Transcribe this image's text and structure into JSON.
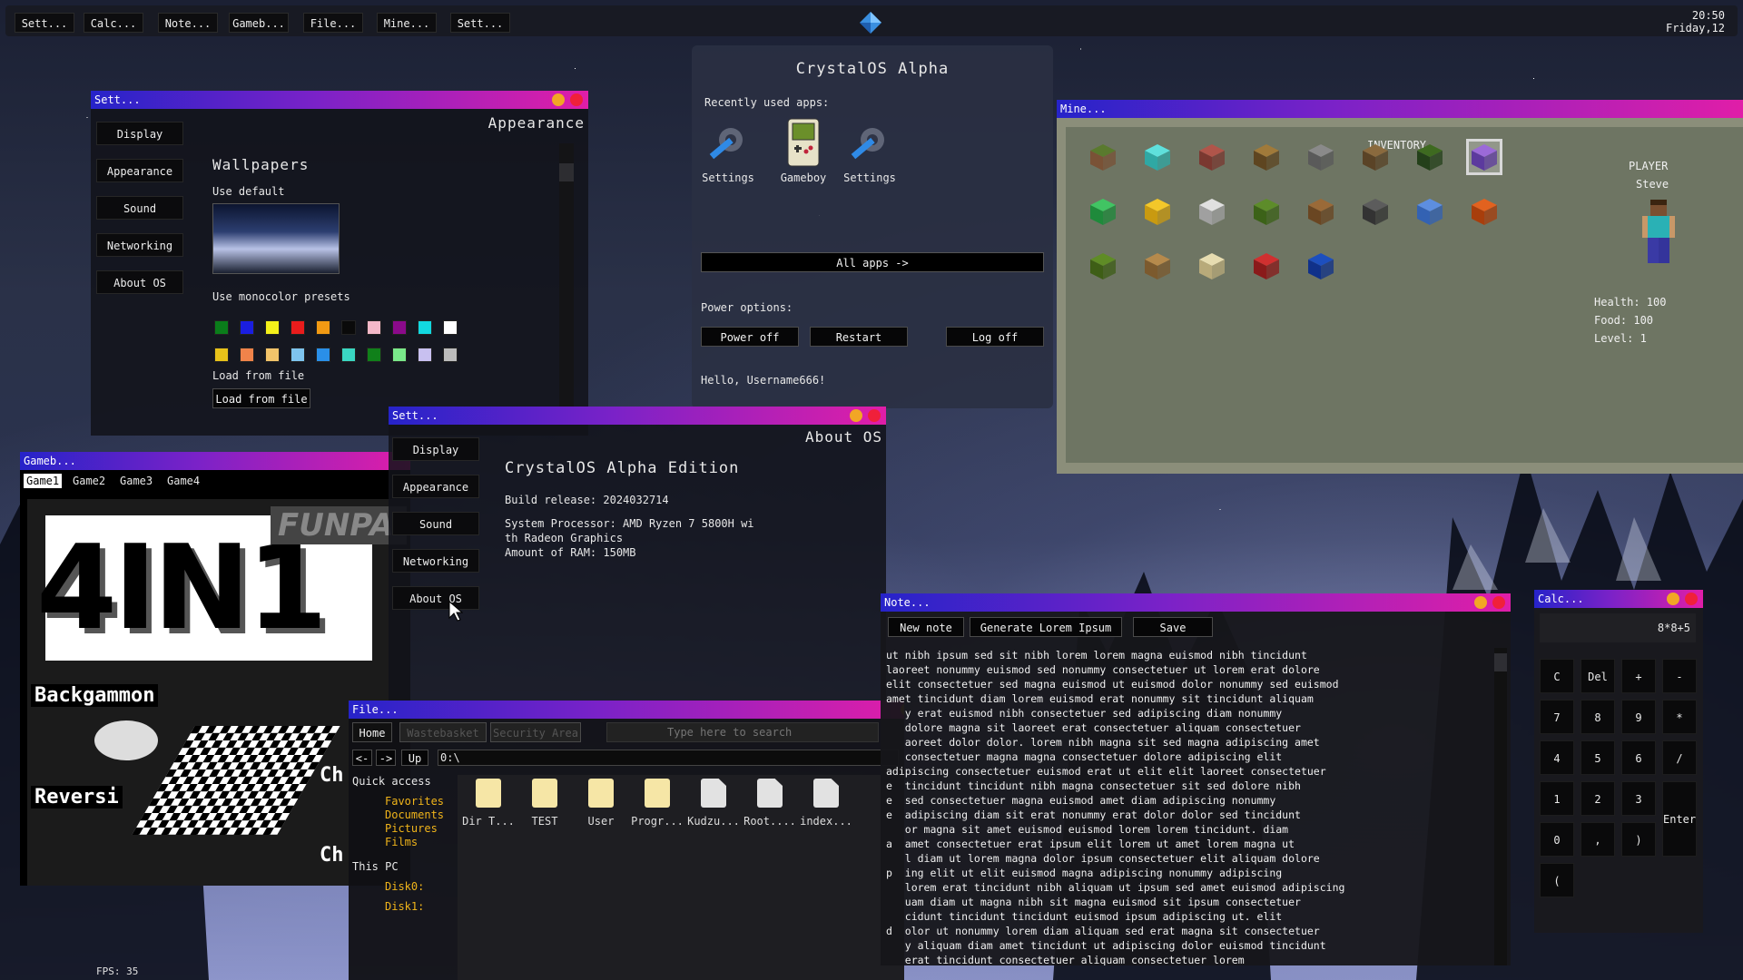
{
  "taskbar": {
    "apps": [
      "Sett...",
      "Calc...",
      "Note...",
      "Gameb...",
      "File...",
      "Mine...",
      "Sett..."
    ],
    "time": "20:50",
    "date": "Friday,12"
  },
  "start_menu": {
    "title": "CrystalOS Alpha",
    "recent_label": "Recently used apps:",
    "recent_apps": [
      "Settings",
      "Gameboy",
      "Settings"
    ],
    "all_apps_label": "All apps ->",
    "power_label": "Power options:",
    "power_off": "Power off",
    "restart": "Restart",
    "log_off": "Log off",
    "greeting": "Hello, Username666!"
  },
  "settings_1": {
    "title": "Sett...",
    "header": "Appearance",
    "nav": [
      "Display",
      "Appearance",
      "Sound",
      "Networking",
      "About OS"
    ],
    "wallpapers_heading": "Wallpapers",
    "use_default": "Use default",
    "monocolor_label": "Use monocolor presets",
    "load_label": "Load from file",
    "load_button": "Load from file",
    "swatches_row1": [
      "#0a7d1a",
      "#1a1ee0",
      "#f4f01a",
      "#e91c1c",
      "#f29a13",
      "#0a0a0a",
      "#f4b8c8",
      "#8b0a8b",
      "#12d8e0",
      "#ffffff"
    ],
    "swatches_row2": [
      "#e8c21a",
      "#f0834a",
      "#f2c46a",
      "#7ec4ee",
      "#2a8fe8",
      "#3ad6c2",
      "#10801a",
      "#7ae88a",
      "#c8c0f0",
      "#bcbcbc"
    ]
  },
  "settings_2": {
    "title": "Sett...",
    "header": "About OS",
    "nav": [
      "Display",
      "Appearance",
      "Sound",
      "Networking",
      "About OS"
    ],
    "edition": "CrystalOS Alpha Edition",
    "build": "Build release: 2024032714",
    "processor_1": "System Processor: AMD Ryzen 7 5800H wi",
    "processor_2": "th Radeon Graphics",
    "ram": "Amount of RAM: 150MB"
  },
  "minecraft": {
    "title": "Mine...",
    "inventory_label": "INVENTORY",
    "player_label": "PLAYER",
    "player_name": "Steve",
    "health": "Health: 100",
    "food": "Food: 100",
    "level": "Level: 1"
  },
  "gameboy": {
    "title": "Gameb...",
    "tabs": [
      "Game1",
      "Game2",
      "Game3",
      "Game4"
    ],
    "banner": "4IN1",
    "banner_sub": "FUNPA",
    "game_backgammon": "Backgammon",
    "game_reversi": "Reversi",
    "game_ch1": "Ch",
    "game_ch2": "Ch",
    "fps": "FPS: 35"
  },
  "file_manager": {
    "title": "File...",
    "tabs": [
      "Home",
      "Wastebasket",
      "Security Area"
    ],
    "search_placeholder": "Type here to search",
    "back": "<-",
    "forward": "->",
    "up": "Up",
    "path": "0:\\",
    "quick_access": "Quick access",
    "quick_items": [
      "Favorites",
      "Documents",
      "Pictures",
      "Films"
    ],
    "this_pc": "This PC",
    "disks": [
      "Disk0:",
      "Disk1:"
    ],
    "items": [
      "Dir T...",
      "TEST",
      "User",
      "Progr...",
      "Kudzu...",
      "Root....",
      "index..."
    ]
  },
  "notepad": {
    "title": "Note...",
    "new_note": "New note",
    "generate": "Generate Lorem Ipsum",
    "save": "Save",
    "lines": [
      "ut nibh ipsum sed sit nibh lorem lorem magna euismod nibh tincidunt",
      "laoreet nonummy euismod sed nonummy consectetuer ut lorem erat dolore",
      "elit consectetuer sed magna euismod ut euismod dolor nonummy sed euismod",
      "amet tincidunt diam lorem euismod erat nonummy sit tincidunt aliquam",
      "   y erat euismod nibh consectetuer sed adipiscing diam nonummy",
      "   dolore magna sit laoreet erat consectetuer aliquam consectetuer",
      "   aoreet dolor dolor. lorem nibh magna sit sed magna adipiscing amet",
      "   consectetuer magna magna consectetuer dolore adipiscing elit",
      "adipiscing consectetuer euismod erat ut elit elit laoreet consectetuer",
      "e  tincidunt tincidunt nibh magna consectetuer sit sed dolore nibh",
      "e  sed consectetuer magna euismod amet diam adipiscing nonummy",
      "e  adipiscing diam sit erat nonummy erat dolor dolor sed tincidunt",
      "   or magna sit amet euismod euismod lorem lorem tincidunt. diam",
      "a  amet consectetuer erat ipsum elit lorem ut amet lorem magna ut",
      "   l diam ut lorem magna dolor ipsum consectetuer elit aliquam dolore",
      "p  ing elit ut elit euismod magna adipiscing nonummy adipiscing",
      "   lorem erat tincidunt nibh aliquam ut ipsum sed amet euismod adipiscing",
      "   uam diam ut magna nibh sit magna euismod sit ipsum consectetuer",
      "   cidunt tincidunt tincidunt euismod ipsum adipiscing ut. elit",
      "d  olor ut nonummy lorem diam aliquam sed erat magna sit consectetuer",
      "   y aliquam diam amet tincidunt ut adipiscing dolor euismod tincidunt",
      "   erat tincidunt consectetuer aliquam consectetuer lorem"
    ]
  },
  "calculator": {
    "title": "Calc...",
    "display": "8*8+5",
    "keys": [
      "C",
      "Del",
      "+",
      "-",
      "7",
      "8",
      "9",
      "*",
      "4",
      "5",
      "6",
      "/",
      "1",
      "2",
      "3",
      "Enter",
      "0",
      ",",
      ")",
      "("
    ]
  },
  "colors": {
    "titlebar_start": "#2623c9",
    "titlebar_end": "#e01ea8",
    "file_link": "#f0b41a",
    "minimize": "#f2a625",
    "close": "#f0203a"
  }
}
